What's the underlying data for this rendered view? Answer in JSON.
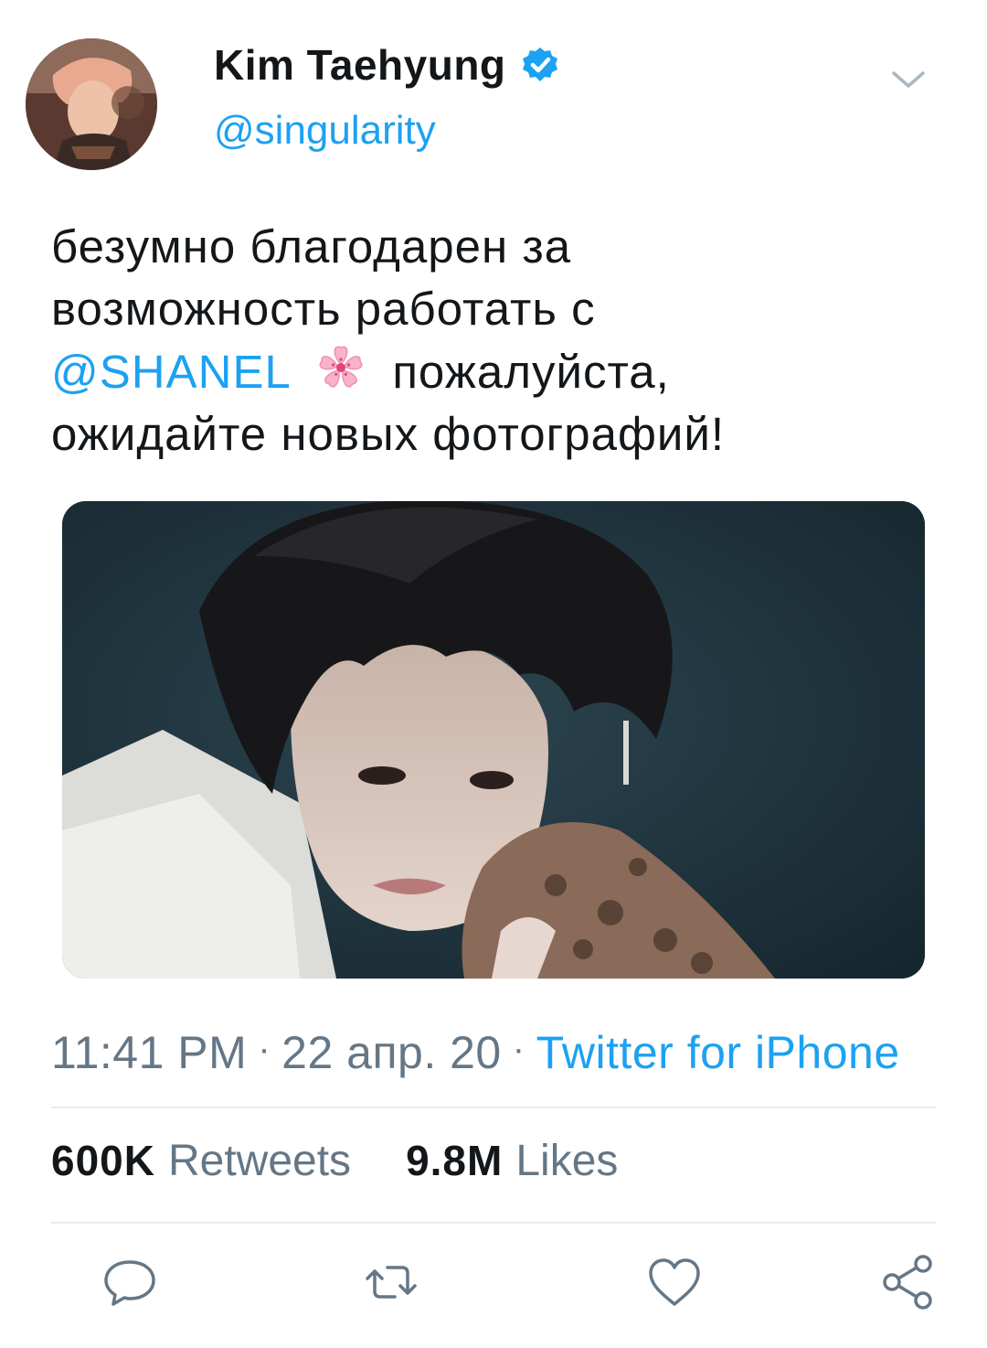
{
  "author": {
    "display_name": "Kim Taehyung",
    "handle": "@singularity",
    "verified": true
  },
  "tweet": {
    "text_line_1": "безумно благодарен за",
    "text_line_2": "возможность работать с",
    "mention": "@SHANEL",
    "emoji": "cherry-blossom-icon",
    "text_line_3_rest": "пожалуйста,",
    "text_line_4": "ожидайте новых фотографий!"
  },
  "meta": {
    "time": "11:41 PM",
    "separator": "·",
    "date": "22 апр. 20",
    "source": "Twitter for iPhone"
  },
  "stats": {
    "retweets_count": "600K",
    "retweets_label": "Retweets",
    "likes_count": "9.8M",
    "likes_label": "Likes"
  },
  "actions": [
    "reply-icon",
    "retweet-icon",
    "like-icon",
    "share-icon"
  ],
  "colors": {
    "accent": "#1da1f2",
    "text": "#14171a",
    "muted": "#657786",
    "divider": "#e6ecf0"
  }
}
